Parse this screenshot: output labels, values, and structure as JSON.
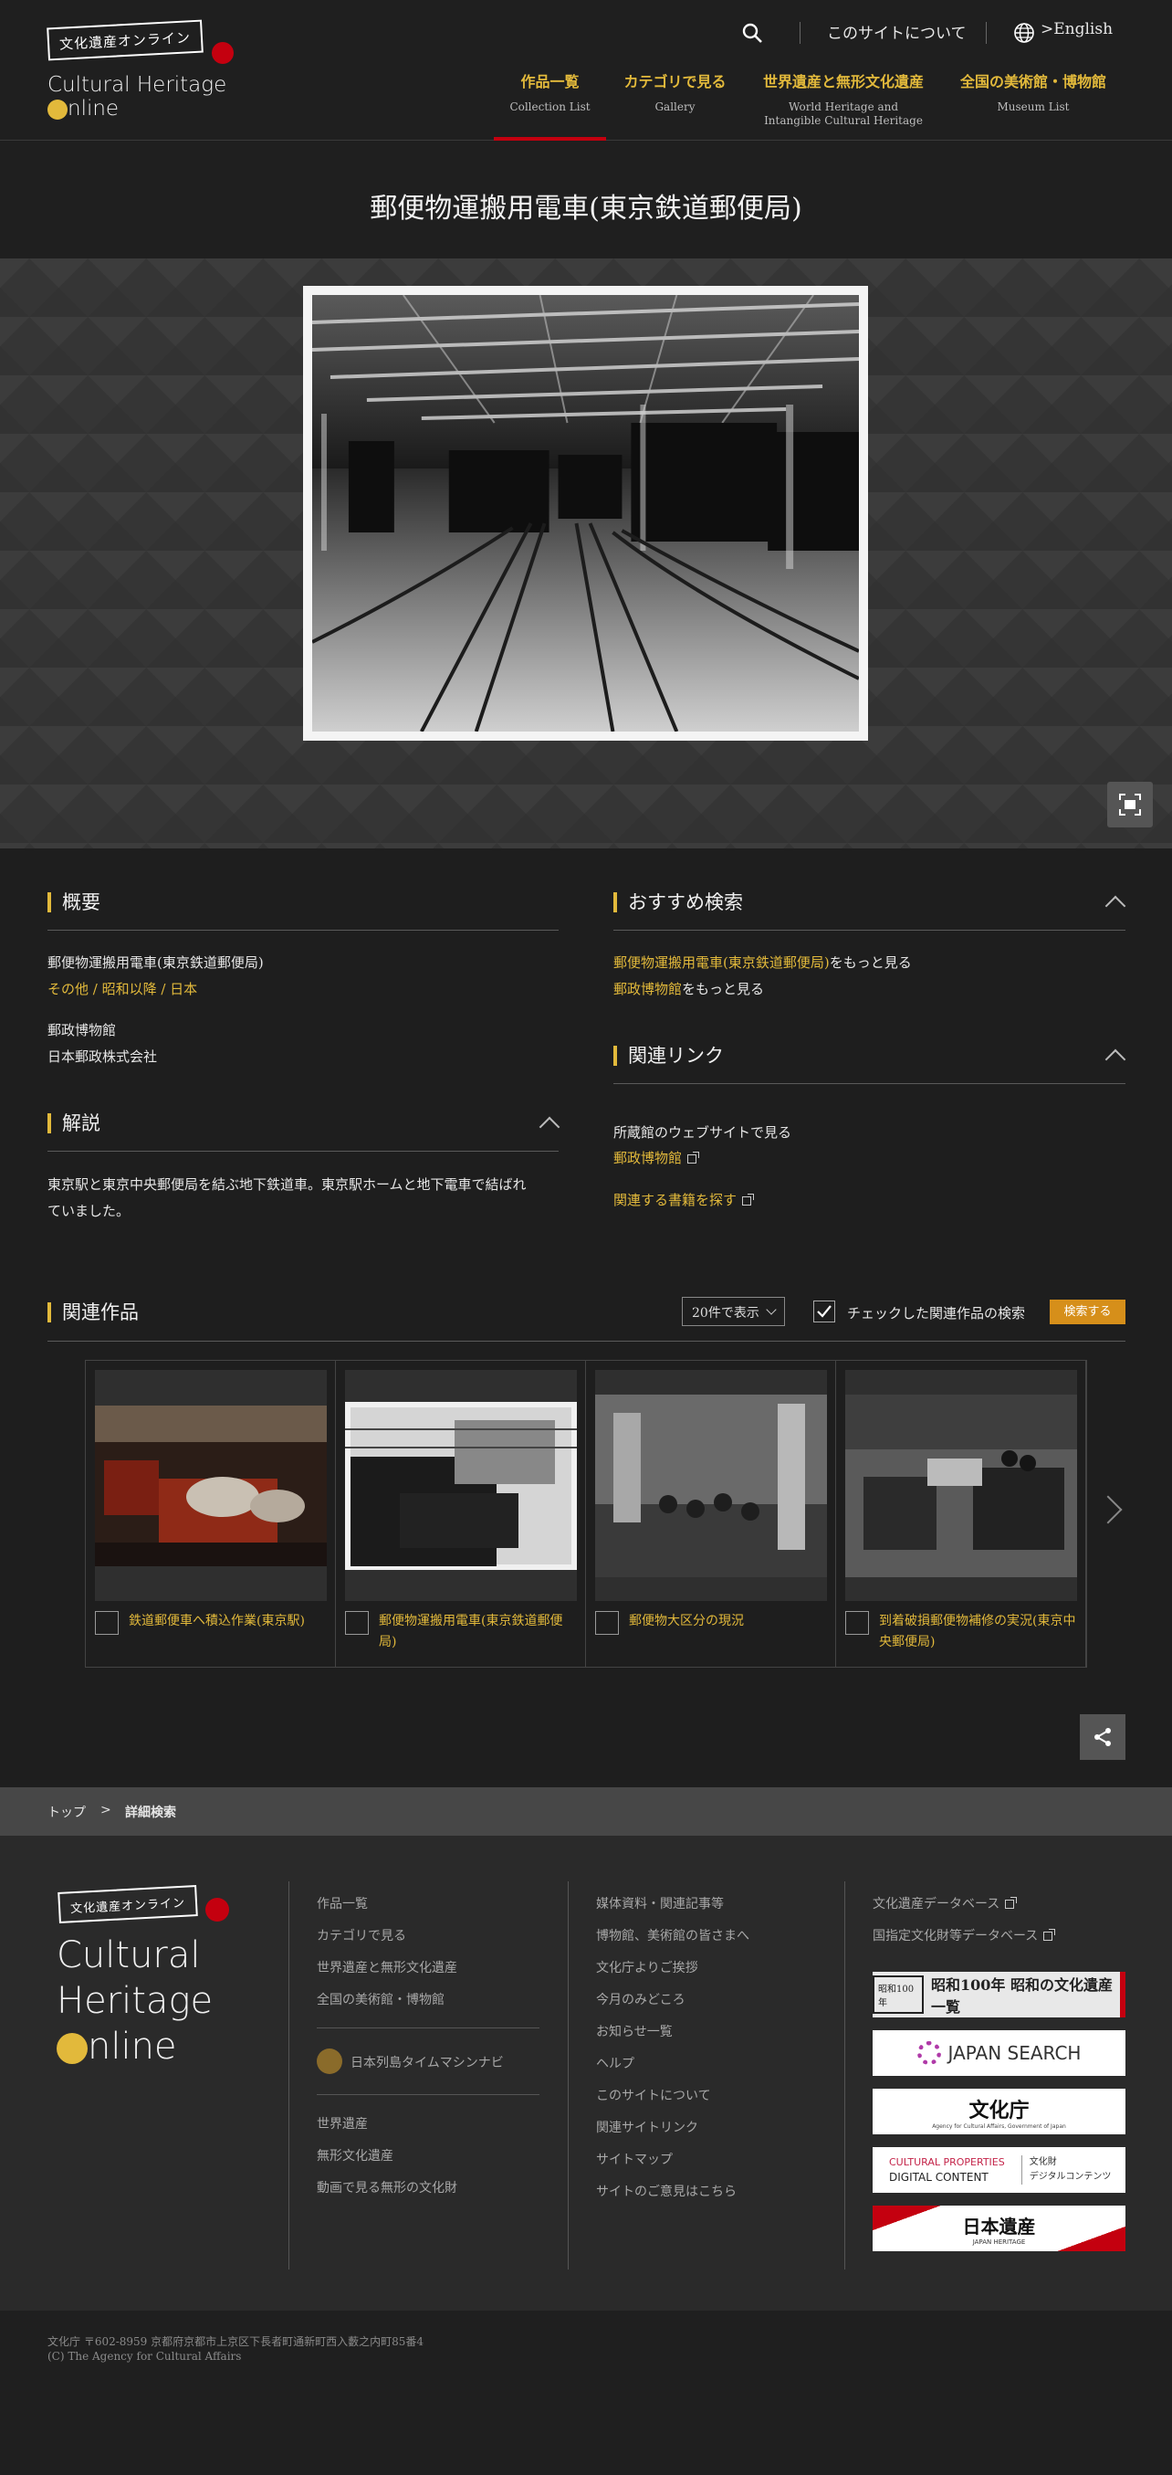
{
  "header": {
    "logo_label": "文化遺産オンライン",
    "logo_line1": "Cultural Heritage",
    "logo_line2": "nline",
    "about_link": "このサイトについて",
    "lang_link": ">English",
    "nav": [
      {
        "jp": "作品一覧",
        "en": "Collection List"
      },
      {
        "jp": "カテゴリで見る",
        "en": "Gallery"
      },
      {
        "jp": "世界遺産と無形文化遺産",
        "en": "World Heritage and",
        "en2": "Intangible Cultural Heritage"
      },
      {
        "jp": "全国の美術館・博物館",
        "en": "Museum List"
      }
    ]
  },
  "page_title": "郵便物運搬用電車(東京鉄道郵便局)",
  "overview": {
    "heading": "概要",
    "name": "郵便物運搬用電車(東京鉄道郵便局)",
    "categories": "その他 / 昭和以降 / 日本",
    "museum": "郵政博物館",
    "owner": "日本郵政株式会社"
  },
  "description": {
    "heading": "解説",
    "text_line1": "東京駅と東京中央郵便局を結ぶ地下鉄道車。東京駅ホームと地下電車で結ばれ",
    "text_line2": "ていました。"
  },
  "recommended": {
    "heading": "おすすめ検索",
    "link1_gold": "郵便物運搬用電車(東京鉄道郵便局)",
    "link1_rest": "をもっと見る",
    "link2_gold": "郵政博物館",
    "link2_rest": "をもっと見る"
  },
  "related_links": {
    "heading": "関連リンク",
    "museum_site_label": "所蔵館のウェブサイトで見る",
    "museum_link": "郵政博物館",
    "books_link": "関連する書籍を探す"
  },
  "related_works": {
    "heading": "関連作品",
    "per_page": "20件で表示",
    "check_search_label": "チェックした関連作品の検索",
    "search_button": "検索する",
    "items": [
      {
        "title": "鉄道郵便車へ積込作業(東京駅)"
      },
      {
        "title": "郵便物運搬用電車(東京鉄道郵便局)"
      },
      {
        "title": "郵便物大区分の現況"
      },
      {
        "title": "到着破損郵便物補修の実況(東京中央郵便局)"
      }
    ]
  },
  "breadcrumb": {
    "top": "トップ",
    "separator": ">",
    "current": "詳細検索"
  },
  "footer": {
    "logo_label": "文化遺産オンライン",
    "logo_lines": [
      "Cultural",
      "Heritage",
      "nline"
    ],
    "col1": [
      "作品一覧",
      "カテゴリで見る",
      "世界遺産と無形文化遺産",
      "全国の美術館・博物館"
    ],
    "timemachine": "日本列島タイムマシンナビ",
    "col1b": [
      "世界遺産",
      "無形文化遺産",
      "動画で見る無形の文化財"
    ],
    "col2": [
      "媒体資料・関連記事等",
      "博物館、美術館の皆さまへ",
      "文化庁よりご挨拶",
      "今月のみどころ",
      "お知らせ一覧",
      "ヘルプ",
      "このサイトについて",
      "関連サイトリンク",
      "サイトマップ",
      "サイトのご意見はこちら"
    ],
    "col3": [
      "文化遺産データベース",
      "国指定文化財等データベース"
    ],
    "banners": {
      "showa": "昭和100年 昭和の文化遺産一覧",
      "showa_badge": "昭和100年",
      "japan_search": "JAPAN SEARCH",
      "bunkacho": "文化庁",
      "bunkacho_sub": "Agency for Cultural Affairs, Government of Japan",
      "cp_line1": "CULTURAL PROPERTIES",
      "cp_line2": "DIGITAL CONTENT",
      "cp_jp1": "文化財",
      "cp_jp2": "デジタルコンテンツ",
      "nihon_isan": "日本遺産",
      "nihon_isan_en": "JAPAN HERITAGE"
    },
    "address": "文化庁 〒602-8959 京都府京都市上京区下長者町通新町西入藪之内町85番4",
    "copyright": "(C) The Agency for Cultural Affairs"
  },
  "colors": {
    "accent_gold": "#e2b93b",
    "accent_red": "#c4000f",
    "search_orange": "#d68f1a"
  }
}
